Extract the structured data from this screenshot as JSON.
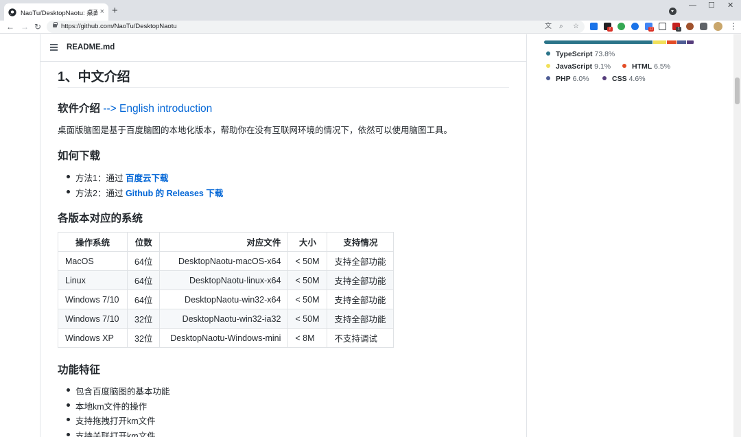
{
  "browser": {
    "tab_title": "NaoTu/DesktopNaotu: 桌面版脑图",
    "tab_close": "×",
    "new_tab": "+",
    "url": "https://github.com/NaoTu/DesktopNaotu",
    "win_minimize": "—",
    "win_maximize": "☐",
    "win_close": "✕",
    "back": "←",
    "forward": "→",
    "reload": "↻",
    "menu": "⋮",
    "extension_badges": [
      "2",
      "11",
      "1"
    ]
  },
  "readme": {
    "filename": "README.md",
    "h1": "1、中文介绍",
    "intro_heading": "软件介绍",
    "intro_link": "--> English introduction",
    "intro_text": "桌面版脑图是基于百度脑图的本地化版本，帮助你在没有互联网环境的情况下，依然可以使用脑图工具。",
    "download_heading": "如何下载",
    "download_items": [
      {
        "prefix": "方法1：通过 ",
        "link": "百度云下载"
      },
      {
        "prefix": "方法2：通过 ",
        "link": "Github 的 Releases 下载"
      }
    ],
    "versions_heading": "各版本对应的系统",
    "table": {
      "headers": [
        "操作系统",
        "位数",
        "对应文件",
        "大小",
        "支持情况"
      ],
      "rows": [
        [
          "MacOS",
          "64位",
          "DesktopNaotu-macOS-x64",
          "< 50M",
          "支持全部功能"
        ],
        [
          "Linux",
          "64位",
          "DesktopNaotu-linux-x64",
          "< 50M",
          "支持全部功能"
        ],
        [
          "Windows 7/10",
          "64位",
          "DesktopNaotu-win32-x64",
          "< 50M",
          "支持全部功能"
        ],
        [
          "Windows 7/10",
          "32位",
          "DesktopNaotu-win32-ia32",
          "< 50M",
          "支持全部功能"
        ],
        [
          "Windows XP",
          "32位",
          "DesktopNaotu-Windows-mini",
          "< 8M",
          "不支持调试"
        ]
      ]
    },
    "features_heading": "功能特征",
    "features": [
      "包含百度脑图的基本功能",
      "本地km文件的操作",
      "支持拖拽打开km文件",
      "支持关联打开km文件"
    ]
  },
  "languages": [
    {
      "name": "TypeScript",
      "percent": "73.8%",
      "value": 73.8,
      "color": "#2b7489"
    },
    {
      "name": "JavaScript",
      "percent": "9.1%",
      "value": 9.1,
      "color": "#f1e05a"
    },
    {
      "name": "HTML",
      "percent": "6.5%",
      "value": 6.5,
      "color": "#e34c26"
    },
    {
      "name": "PHP",
      "percent": "6.0%",
      "value": 6.0,
      "color": "#4F5D95"
    },
    {
      "name": "CSS",
      "percent": "4.6%",
      "value": 4.6,
      "color": "#563d7c"
    }
  ]
}
